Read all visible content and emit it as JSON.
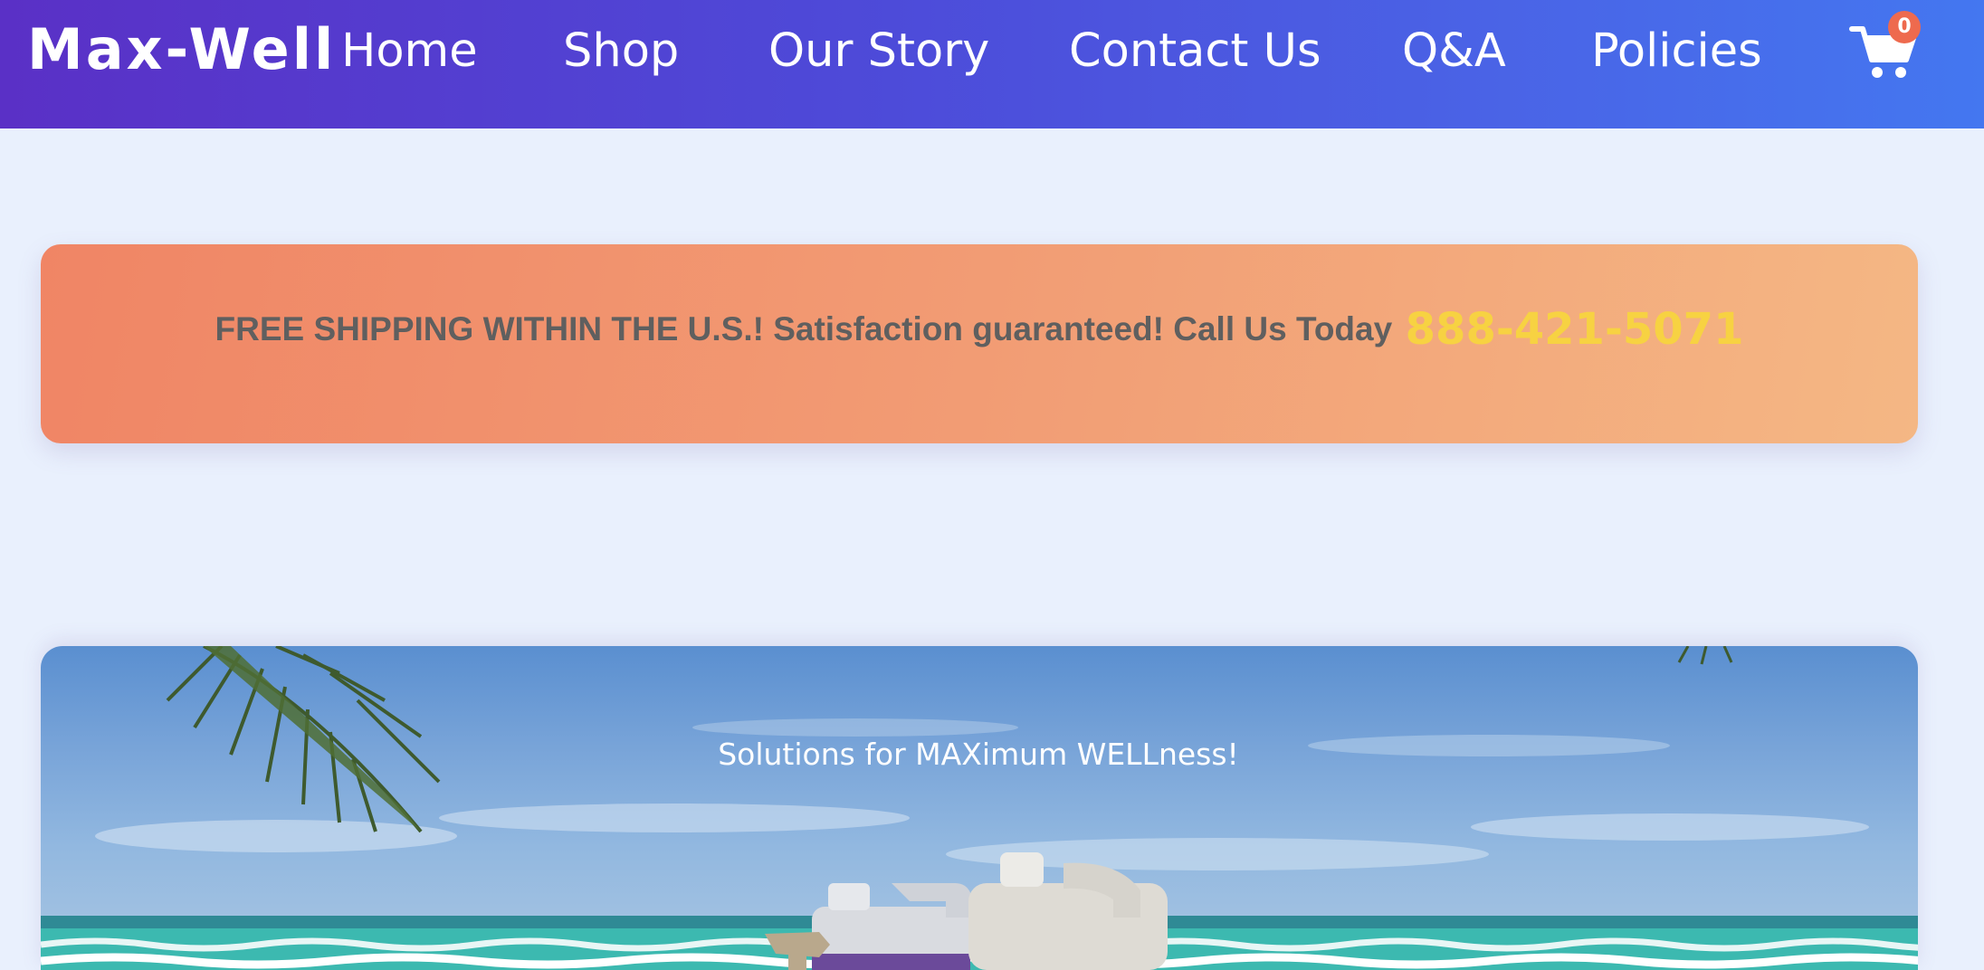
{
  "nav": {
    "brand": "Max-Well",
    "links": [
      "Home",
      "Shop",
      "Our Story",
      "Contact Us",
      "Q&A",
      "Policies"
    ],
    "cart_count": "0",
    "cart_icon": "shopping-cart-icon"
  },
  "promo": {
    "text": "FREE SHIPPING WITHIN THE U.S.! Satisfaction guaranteed! Call Us Today",
    "phone": "888-421-5071"
  },
  "hero": {
    "tagline": "Solutions for MAXimum WELLness!",
    "scene": "beach-with-palm-and-product-jugs"
  },
  "colors": {
    "nav_start": "#5a30c6",
    "nav_end": "#4477f0",
    "page_bg": "#e9f0fd",
    "promo_start": "#f08565",
    "promo_end": "#f4b784",
    "phone": "#f7d242",
    "badge": "#ee6a4e"
  }
}
